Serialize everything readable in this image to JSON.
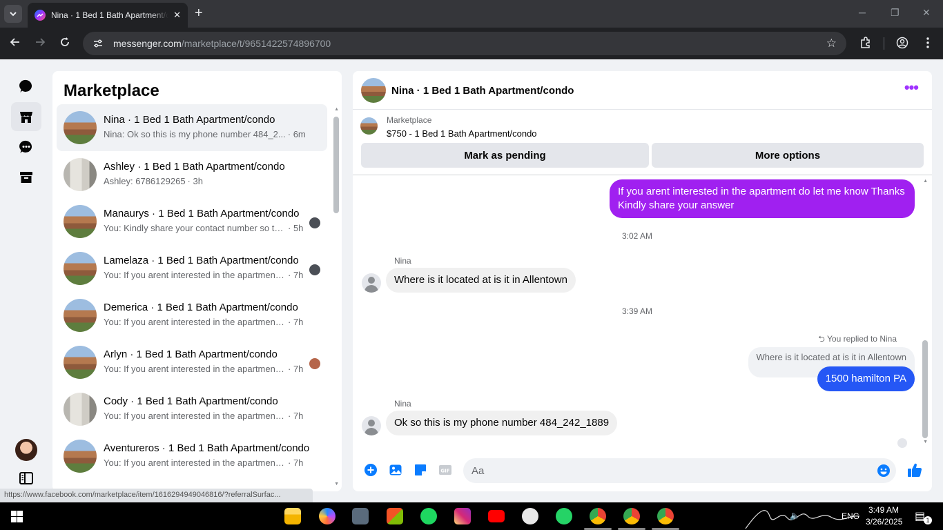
{
  "browser": {
    "tab_title": "Nina · 1 Bed 1 Bath Apartment/condo",
    "url_host": "messenger.com",
    "url_path": "/marketplace/t/9651422574896700",
    "status_url": "https://www.facebook.com/marketplace/item/1616294949046816/?referralSurfac..."
  },
  "sidebar_title": "Marketplace",
  "conversations": [
    {
      "name": "Nina · 1 Bed 1 Bath Apartment/condo",
      "preview": "Nina: Ok so this is my phone number 484_2...",
      "time": "· 6m",
      "thumb": "building",
      "selected": true
    },
    {
      "name": "Ashley · 1 Bed 1 Bath Apartment/condo",
      "preview": "Ashley: 6786129265",
      "time": "· 3h",
      "thumb": "room"
    },
    {
      "name": "Manaurys · 1 Bed 1 Bath Apartment/condo",
      "preview": "You: Kindly share your contact number so th...",
      "time": "· 5h",
      "thumb": "building"
    },
    {
      "name": "Lamelaza · 1 Bed 1 Bath Apartment/condo",
      "preview": "You: If you arent interested in the apartment ...",
      "time": "· 7h",
      "thumb": "building"
    },
    {
      "name": "Demerica · 1 Bed 1 Bath Apartment/condo",
      "preview": "You: If you arent interested in the apartment ...",
      "time": "· 7h",
      "thumb": "building"
    },
    {
      "name": "Arlyn · 1 Bed 1 Bath Apartment/condo",
      "preview": "You: If you arent interested in the apartment ...",
      "time": "· 7h",
      "thumb": "building"
    },
    {
      "name": "Cody · 1 Bed 1 Bath Apartment/condo",
      "preview": "You: If you arent interested in the apartment ...",
      "time": "· 7h",
      "thumb": "room"
    },
    {
      "name": "Aventureros · 1 Bed 1 Bath Apartment/condo",
      "preview": "You: If you arent interested in the apartment ...",
      "time": "· 7h",
      "thumb": "building"
    }
  ],
  "chat": {
    "title": "Nina · 1 Bed 1 Bath Apartment/condo",
    "listing_label": "Marketplace",
    "listing_price": "$750 - 1 Bed 1 Bath Apartment/condo",
    "mark_pending_label": "Mark as pending",
    "more_options_label": "More options",
    "outgoing_1": "If you arent interested in the apartment do let me know Thanks Kindly share your answer",
    "time_1": "3:02 AM",
    "sender_1": "Nina",
    "incoming_1": "Where is it located at is it in Allentown",
    "time_2": "3:39 AM",
    "reply_note": "You replied to Nina",
    "quoted_text": "Where is it located at is it in Allentown",
    "outgoing_2": "1500 hamilton PA",
    "sender_2": "Nina",
    "incoming_2": "Ok so this is my phone number 484_242_1889",
    "composer_placeholder": "Aa"
  },
  "taskbar": {
    "time": "3:49 AM",
    "date": "3/26/2025",
    "lang": "ENG",
    "notification_count": "1"
  },
  "colors": {
    "accent_purple": "#a020f0",
    "bubble_blue": "#2557f5",
    "messenger_blue": "#0a7cff"
  }
}
